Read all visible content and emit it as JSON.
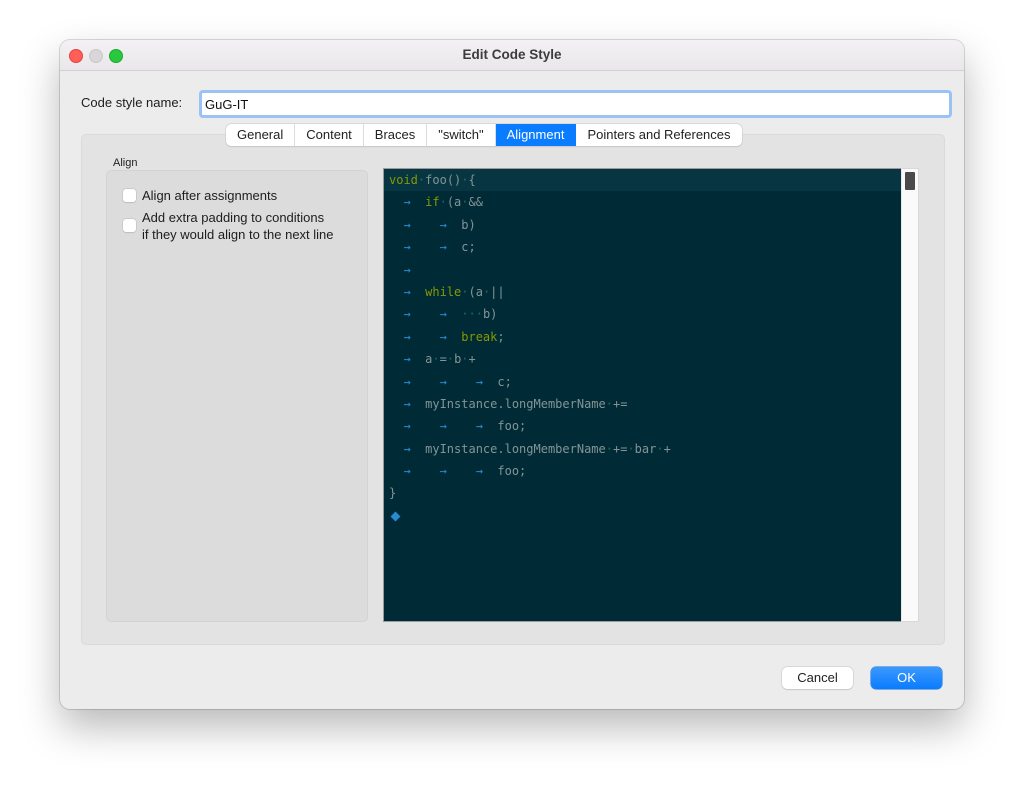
{
  "window": {
    "title": "Edit Code Style"
  },
  "form": {
    "name_label": "Code style name:",
    "name_value": "GuG-IT"
  },
  "tabs": [
    {
      "label": "General",
      "active": false
    },
    {
      "label": "Content",
      "active": false
    },
    {
      "label": "Braces",
      "active": false
    },
    {
      "label": "\"switch\"",
      "active": false
    },
    {
      "label": "Alignment",
      "active": true
    },
    {
      "label": "Pointers and References",
      "active": false
    }
  ],
  "align_group": {
    "label": "Align",
    "options": [
      {
        "label": "Align after assignments",
        "checked": false
      },
      {
        "label": "Add extra padding to conditions",
        "label_line2": "if they would align to the next line",
        "checked": false
      }
    ]
  },
  "preview": {
    "theme_colors": {
      "background": "#002b36",
      "keyword": "#859900",
      "text": "#839496",
      "tab_arrow": "#268bd2"
    },
    "lines": [
      "void foo() {",
      "\tif (a &&",
      "\t\tb)",
      "\t\tc;",
      "\t",
      "\twhile (a ||",
      "\t\t   b)",
      "\t\tbreak;",
      "\ta = b +",
      "\t\t\tc;",
      "\tmyInstance.longMemberName +=",
      "\t\t\tfoo;",
      "\tmyInstance.longMemberName += bar +",
      "\t\t\tfoo;",
      "}",
      ""
    ],
    "keywords": [
      "void",
      "if",
      "while",
      "break"
    ]
  },
  "buttons": {
    "cancel": "Cancel",
    "ok": "OK"
  }
}
